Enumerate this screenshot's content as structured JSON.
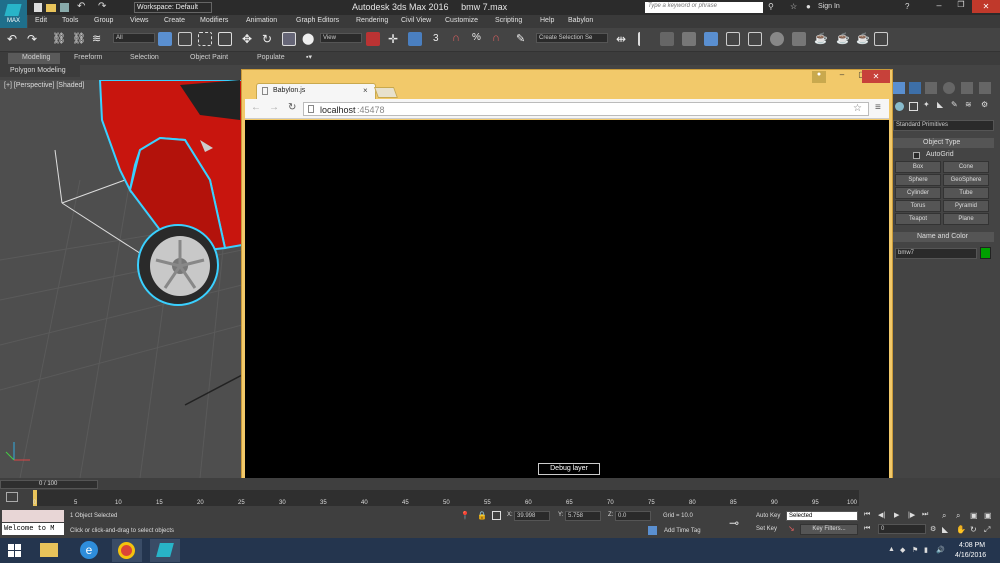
{
  "app": {
    "title": "Autodesk 3ds Max 2016     bmw 7.max",
    "workspace": "Workspace: Default",
    "search_placeholder": "Type a keyword or phrase",
    "sign_in": "Sign In",
    "logo": "MAX"
  },
  "menu": [
    "Edit",
    "Tools",
    "Group",
    "Views",
    "Create",
    "Modifiers",
    "Animation",
    "Graph Editors",
    "Rendering",
    "Civil View",
    "Customize",
    "Scripting",
    "Help",
    "Babylon"
  ],
  "toolbar": {
    "filter_value": "All",
    "view_value": "View",
    "count": "3",
    "selection_set": "Create Selection Se"
  },
  "ribbon": {
    "tabs": [
      "Modeling",
      "Freeform",
      "Selection",
      "Object Paint",
      "Populate"
    ],
    "sub": "Polygon Modeling"
  },
  "viewport": {
    "label": "[+] [Perspective] [Shaded]"
  },
  "browser": {
    "tab_title": "Babylon.js",
    "url_host": "localhost",
    "url_port": ":45478",
    "debug_button": "Debug layer"
  },
  "command_panel": {
    "category": "Standard Primitives",
    "object_type_header": "Object Type",
    "autogrid": "AutoGrid",
    "primitives": [
      "Box",
      "Cone",
      "Sphere",
      "GeoSphere",
      "Cylinder",
      "Tube",
      "Torus",
      "Pyramid",
      "Teapot",
      "Plane"
    ],
    "name_color_header": "Name and Color",
    "object_name": "bmw7",
    "object_color": "#00a000"
  },
  "timeline": {
    "frame_range": "0 / 100",
    "ticks": [
      "0",
      "5",
      "10",
      "15",
      "20",
      "25",
      "30",
      "35",
      "40",
      "45",
      "50",
      "55",
      "60",
      "65",
      "70",
      "75",
      "80",
      "85",
      "90",
      "95",
      "100"
    ]
  },
  "status": {
    "welcome": "Welcome to M",
    "selected": "1 Object Selected",
    "prompt": "Click or click-and-drag to select objects",
    "x_label": "X:",
    "x_value": "39.998",
    "y_label": "Y:",
    "y_value": "5.758",
    "z_label": "Z:",
    "z_value": "0.0",
    "grid": "Grid = 10.0",
    "add_time_tag": "Add Time Tag",
    "auto_key": "Auto Key",
    "set_key": "Set Key",
    "key_mode": "Selected",
    "key_filters": "Key Filters...",
    "frame": "0"
  },
  "taskbar": {
    "time": "4:08 PM",
    "date": "4/16/2016"
  }
}
